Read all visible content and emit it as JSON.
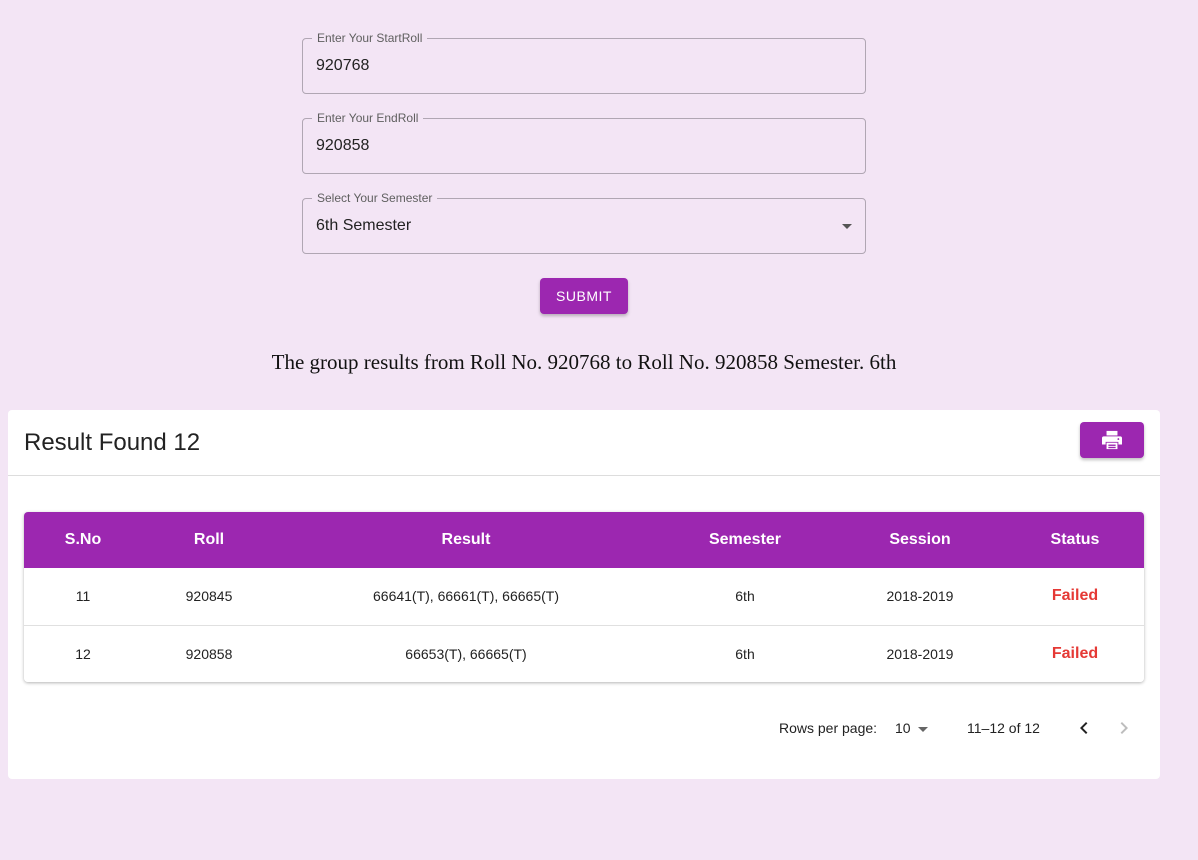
{
  "form": {
    "start_roll": {
      "label": "Enter Your StartRoll",
      "value": "920768"
    },
    "end_roll": {
      "label": "Enter Your EndRoll",
      "value": "920858"
    },
    "semester": {
      "label": "Select Your Semester",
      "value": "6th Semester"
    },
    "submit_label": "SUBMIT"
  },
  "group_title": "The group results from Roll No. 920768 to Roll No. 920858 Semester. 6th",
  "card": {
    "title": "Result Found 12",
    "print_icon": "print-icon"
  },
  "table": {
    "headers": [
      "S.No",
      "Roll",
      "Result",
      "Semester",
      "Session",
      "Status"
    ],
    "rows": [
      {
        "sno": "11",
        "roll": "920845",
        "result": "66641(T), 66661(T), 66665(T)",
        "semester": "6th",
        "session": "2018-2019",
        "status": "Failed"
      },
      {
        "sno": "12",
        "roll": "920858",
        "result": "66653(T), 66665(T)",
        "semester": "6th",
        "session": "2018-2019",
        "status": "Failed"
      }
    ]
  },
  "pagination": {
    "rows_per_page_label": "Rows per page:",
    "rows_per_page_value": "10",
    "range_label": "11–12 of 12"
  },
  "colors": {
    "accent": "#9c27b0",
    "page_background": "#f3e5f5",
    "failed": "#e53935"
  }
}
